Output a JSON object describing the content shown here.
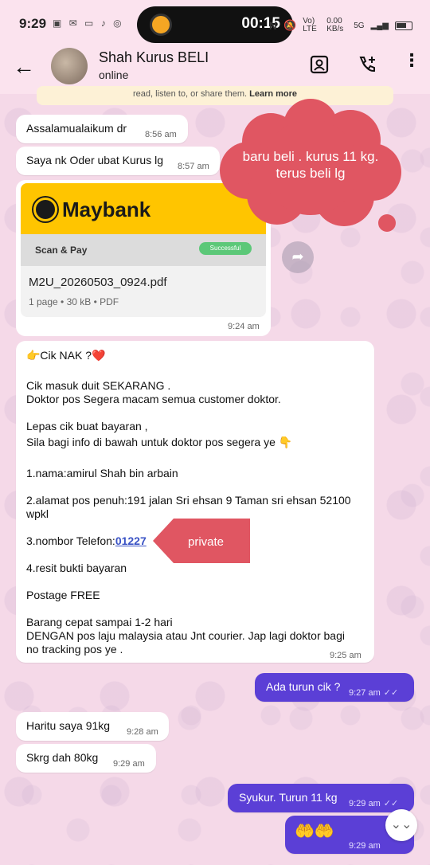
{
  "status_bar": {
    "time": "9:29",
    "timer": "00:15",
    "network": "Vo) LTE",
    "speed": "0.00 KB/s",
    "signal": "5G"
  },
  "header": {
    "contact_name": "Shah Kurus BELI",
    "contact_status": "online"
  },
  "banner": {
    "text": "read, listen to, or share them.",
    "learn_more": "Learn more"
  },
  "messages": [
    {
      "id": "m1",
      "text": "Assalamualaikum dr",
      "time": "8:56 am"
    },
    {
      "id": "m2",
      "text": "Saya nk Oder ubat Kurus lg",
      "time": "8:57 am"
    },
    {
      "id": "m10",
      "text": "Haritu saya 91kg",
      "time": "9:28 am"
    },
    {
      "id": "m11",
      "text": "Skrg dah 80kg",
      "time": "9:29 am"
    }
  ],
  "pdf": {
    "brand": "Maybank",
    "scan_label": "Scan & Pay",
    "success_label": "Successful",
    "filename": "M2U_20260503_0924.pdf",
    "meta": "1 page • 30 kB • PDF",
    "time": "9:24 am"
  },
  "big_message": {
    "line1": "👉Cik NAK ?❤️",
    "line2": " Cik masuk duit  SEKARANG .",
    "line3": " Doktor pos   Segera macam semua customer doktor.",
    "line4": "Lepas cik buat bayaran ,",
    "line5": "Sila bagi info di bawah untuk doktor pos segera ye 👇",
    "line6": "1.nama:amirul Shah bin arbain",
    "line7": "2.alamat pos penuh:191 jalan Sri ehsan 9 Taman sri ehsan 52100",
    "line8": "wpkl",
    "line9_prefix": "3.nombor Telefon:",
    "line9_link": "01227",
    "line10": "4.resit bukti  bayaran",
    "line11": "Postage FREE",
    "line12": "Barang cepat sampai 1-2 hari",
    "line13": "DENGAN pos laju malaysia atau Jnt courier. Jap lagi doktor bagi",
    "line14": "no tracking pos ye .",
    "time": "9:25 am"
  },
  "outgoing": [
    {
      "id": "o1",
      "text": "Ada turun cik ?",
      "time": "9:27 am"
    },
    {
      "id": "o2",
      "text": "Syukur.  Turun 11 kg",
      "time": "9:29 am"
    },
    {
      "id": "o3",
      "text": "🤲🤲",
      "time": "9:29 am"
    }
  ],
  "annotations": {
    "cloud_text": "baru beli . kurus 11 kg. terus beli lg",
    "tag_text": "private",
    "annotation_color": "#e05662"
  },
  "colors": {
    "accent": "#5b3fd6",
    "background": "#f6dcea"
  }
}
